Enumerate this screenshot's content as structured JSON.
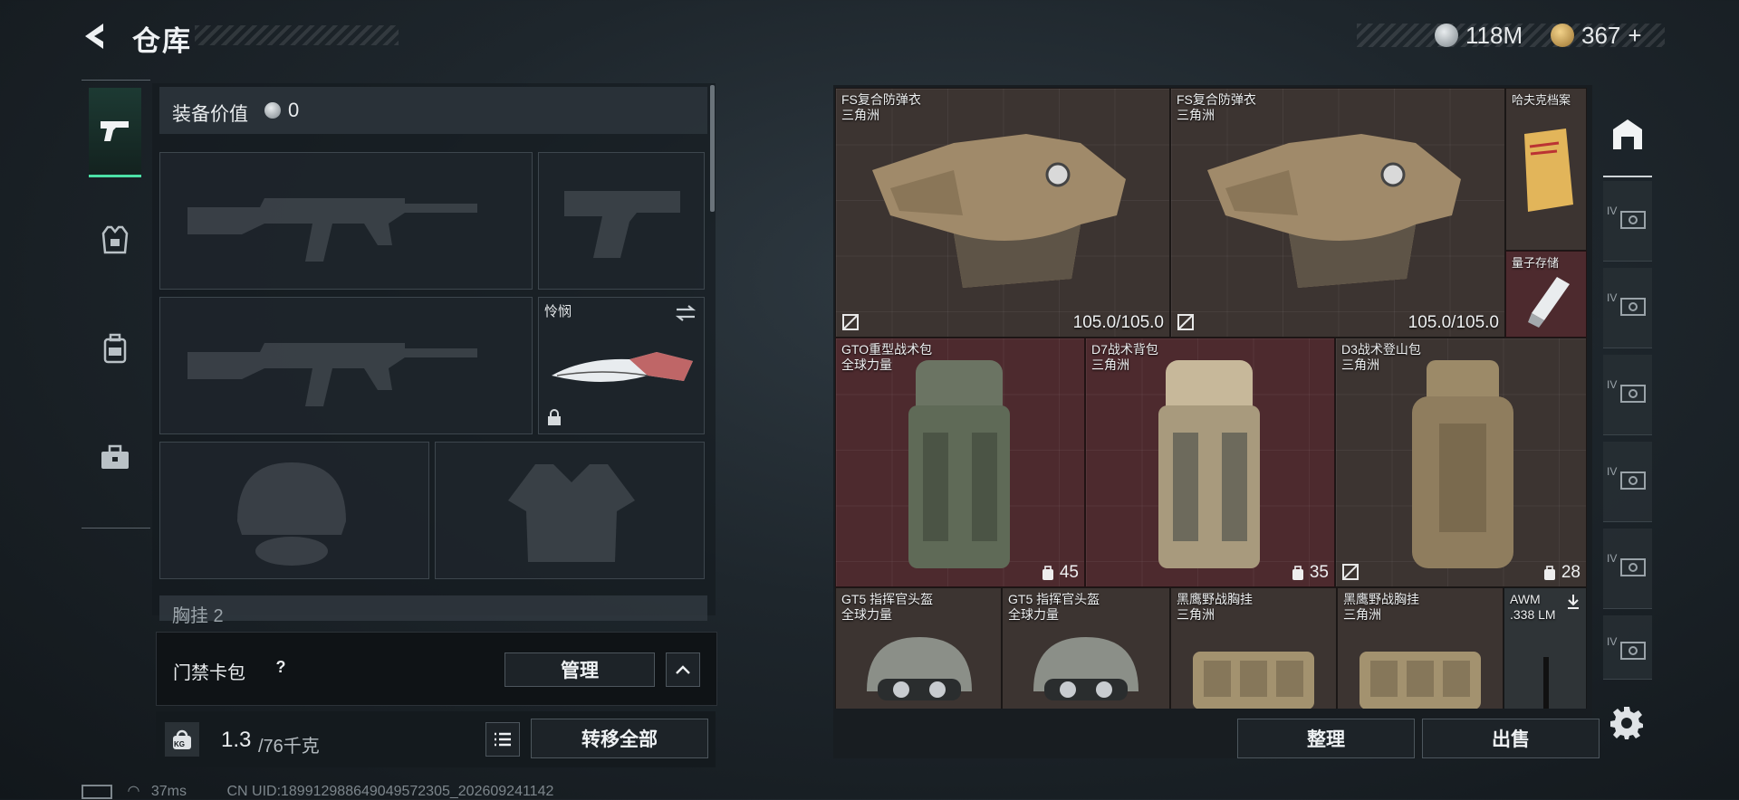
{
  "header": {
    "title": "仓库",
    "currencies": [
      {
        "icon": "silver-coin-icon",
        "amount": "118M"
      },
      {
        "icon": "gold-coin-icon",
        "amount": "367",
        "add_label": "+"
      }
    ]
  },
  "tabs": [
    {
      "icon": "pistol-icon",
      "active": true
    },
    {
      "icon": "armor-icon",
      "active": false
    },
    {
      "icon": "backpack-icon",
      "active": false
    },
    {
      "icon": "toolbox-icon",
      "active": false
    }
  ],
  "loadout": {
    "equip_value_label": "装备价值",
    "equip_value": "0",
    "melee_name": "怜悯",
    "partial_section": "胸挂 2"
  },
  "card_pack": {
    "label": "门禁卡包",
    "help": "?",
    "manage_label": "管理"
  },
  "weight": {
    "unit_icon": "KG",
    "current": "1.3",
    "max_text": "/76千克",
    "transfer_all_label": "转移全部"
  },
  "storage": {
    "items": [
      {
        "name": "FS复合防弹衣",
        "sub": "三角洲",
        "durability": "105.0/105.0",
        "type": "armor"
      },
      {
        "name": "FS复合防弹衣",
        "sub": "三角洲",
        "durability": "105.0/105.0",
        "type": "armor"
      },
      {
        "name": "哈夫克档案",
        "sub": "",
        "type": "file"
      },
      {
        "name": "量子存储",
        "sub": "",
        "type": "drive"
      },
      {
        "name": "GTO重型战术包",
        "sub": "全球力量",
        "capacity": "45",
        "type": "backpack"
      },
      {
        "name": "D7战术背包",
        "sub": "三角洲",
        "capacity": "35",
        "type": "backpack"
      },
      {
        "name": "D3战术登山包",
        "sub": "三角洲",
        "capacity": "28",
        "type": "backpack"
      },
      {
        "name": "GT5 指挥官头盔",
        "sub": "全球力量",
        "type": "helmet"
      },
      {
        "name": "GT5 指挥官头盔",
        "sub": "全球力量",
        "type": "helmet"
      },
      {
        "name": "黑鹰野战胸挂",
        "sub": "三角洲",
        "type": "rig"
      },
      {
        "name": "黑鹰野战胸挂",
        "sub": "三角洲",
        "type": "rig"
      },
      {
        "name": "AWM",
        "sub": ".338 LM",
        "type": "ammo"
      }
    ],
    "sort_label": "整理",
    "sell_label": "出售"
  },
  "sidebar": {
    "slot_label": "IV",
    "settings_icon": "gear-icon"
  },
  "status_bar": {
    "ping": "37ms",
    "uid": "CN UID:18991298864904957230​5_202609241142"
  },
  "colors": {
    "accent": "#4be0a6",
    "storage_red": "#4d2a2e",
    "storage_brown": "#3c3431"
  }
}
